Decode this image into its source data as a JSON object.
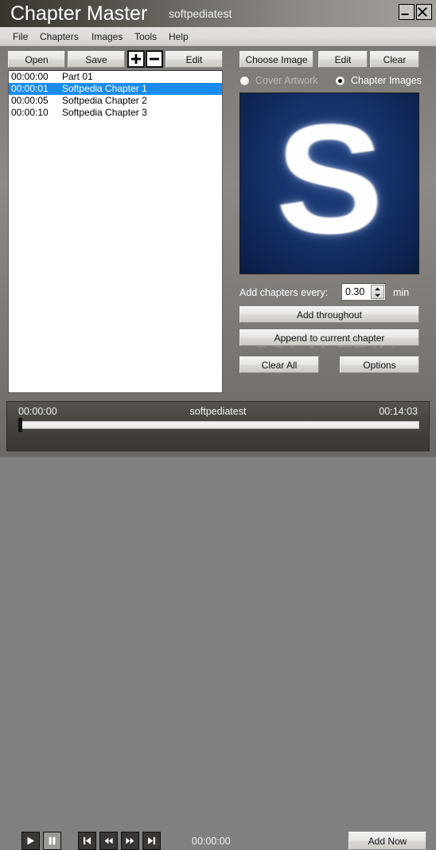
{
  "window": {
    "app_title": "Chapter Master",
    "document_title": "softpediatest",
    "minimize_label": "Minimize",
    "close_label": "Close"
  },
  "menubar": {
    "items": [
      {
        "label": "File"
      },
      {
        "label": "Chapters"
      },
      {
        "label": "Images"
      },
      {
        "label": "Tools"
      },
      {
        "label": "Help"
      }
    ]
  },
  "left_panel": {
    "toolbar": {
      "open": "Open",
      "save": "Save",
      "add": "+",
      "remove": "−",
      "edit": "Edit"
    },
    "chapters": [
      {
        "time": "00:00:00",
        "name": "Part 01",
        "selected": false
      },
      {
        "time": "00:00:01",
        "name": "Softpedia Chapter 1",
        "selected": true
      },
      {
        "time": "00:00:05",
        "name": "Softpedia Chapter 2",
        "selected": false
      },
      {
        "time": "00:00:10",
        "name": "Softpedia Chapter 3",
        "selected": false
      }
    ]
  },
  "right_panel": {
    "image_buttons": {
      "choose": "Choose Image",
      "edit": "Edit",
      "clear": "Clear"
    },
    "image_mode": {
      "cover_artwork": "Cover Artwork",
      "chapter_images": "Chapter Images",
      "selected": "chapter_images"
    },
    "preview": {
      "letter": "S",
      "background_color": "#16336a",
      "letter_color": "#fdfdfd"
    },
    "auto_add": {
      "label": "Add chapters every:",
      "value": "0.30",
      "unit": "min"
    },
    "actions": {
      "add_throughout": "Add throughout",
      "append_to_current": "Append to current chapter",
      "clear_all": "Clear All",
      "options": "Options"
    },
    "watermark": "SOFTPEDIA"
  },
  "player": {
    "current_time": "00:00:00",
    "title": "softpediatest",
    "total_time": "00:14:03",
    "position_time": "00:00:00",
    "progress_percent": 0,
    "transport": {
      "play": "Play",
      "pause": "Pause",
      "skip_start": "Skip to start",
      "rewind": "Rewind",
      "fast_forward": "Fast forward",
      "skip_end": "Skip to end"
    },
    "add_now": "Add Now"
  },
  "colors": {
    "selection_blue": "#1a8cf0",
    "window_gray": "#8c8986",
    "titlebar_dark": "#38352f",
    "player_dark": "#4a4743"
  }
}
